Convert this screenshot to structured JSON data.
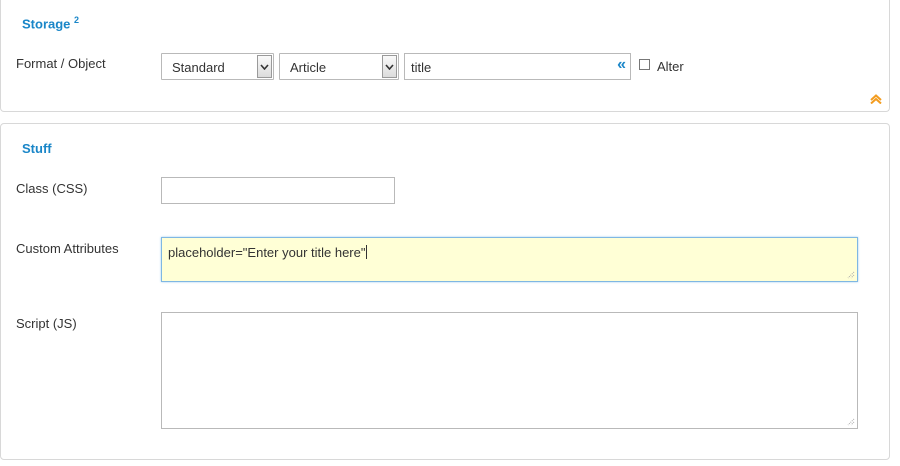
{
  "storage": {
    "title": "Storage",
    "superscript": "2",
    "format_label": "Format / Object",
    "format_select": "Standard",
    "object_select": "Article",
    "field_value": "title",
    "field_button": "«",
    "alter_label": "Alter",
    "alter_checked": false,
    "collapse_icon": "chevron-up-icon",
    "accent": "#f39c1f"
  },
  "stuff": {
    "title": "Stuff",
    "class_label": "Class (CSS)",
    "class_value": "",
    "attrs_label": "Custom Attributes",
    "attrs_value": "placeholder=\"Enter your title here\"",
    "script_label": "Script (JS)",
    "script_value": ""
  },
  "colors": {
    "title": "#1a86c8",
    "focus_bg": "#ffffd6",
    "focus_border": "#7fb7e3"
  }
}
